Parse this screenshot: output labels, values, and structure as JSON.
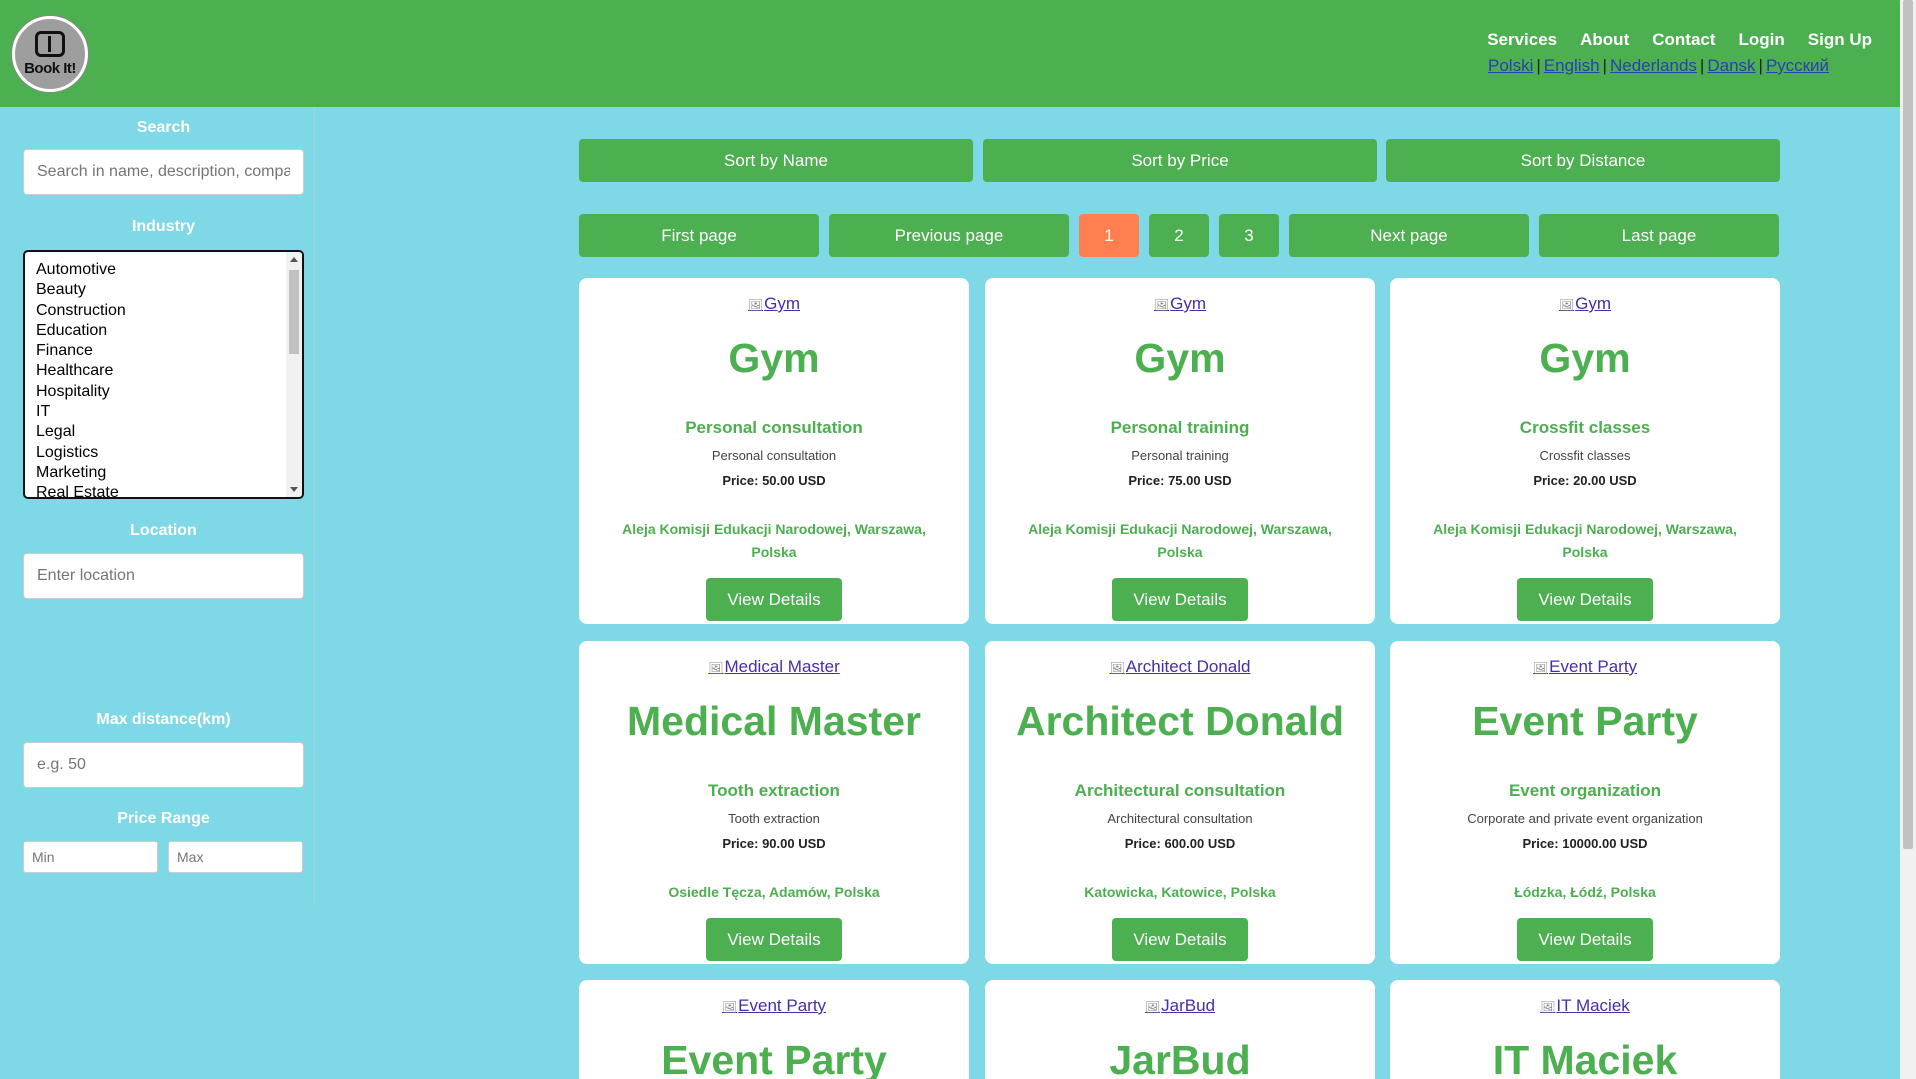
{
  "header": {
    "logo_text": "Book It!",
    "nav": [
      "Services",
      "About",
      "Contact",
      "Login",
      "Sign Up"
    ],
    "languages": [
      "Polski",
      "English",
      "Nederlands",
      "Dansk",
      "Русский"
    ]
  },
  "sidebar": {
    "search": {
      "label": "Search",
      "placeholder": "Search in name, description, company"
    },
    "industry": {
      "label": "Industry",
      "options": [
        "Automotive",
        "Beauty",
        "Construction",
        "Education",
        "Finance",
        "Healthcare",
        "Hospitality",
        "IT",
        "Legal",
        "Logistics",
        "Marketing",
        "Real Estate"
      ]
    },
    "location": {
      "label": "Location",
      "placeholder": "Enter location"
    },
    "max_distance": {
      "label": "Max distance(km)",
      "placeholder": "e.g. 50"
    },
    "price_range": {
      "label": "Price Range",
      "min_placeholder": "Min",
      "max_placeholder": "Max"
    }
  },
  "sort": [
    "Sort by Name",
    "Sort by Price",
    "Sort by Distance"
  ],
  "pagination": {
    "first": "First page",
    "previous": "Previous page",
    "pages": [
      "1",
      "2",
      "3"
    ],
    "current": "1",
    "next": "Next page",
    "last": "Last page"
  },
  "cards": [
    {
      "img_alt": "Gym",
      "title": "Gym",
      "service": "Personal consultation",
      "desc": "Personal consultation",
      "price": "Price: 50.00 USD",
      "address": "Aleja Komisji Edukacji Narodowej, Warszawa, Polska",
      "button": "View Details"
    },
    {
      "img_alt": "Gym",
      "title": "Gym",
      "service": "Personal training",
      "desc": "Personal training",
      "price": "Price: 75.00 USD",
      "address": "Aleja Komisji Edukacji Narodowej, Warszawa, Polska",
      "button": "View Details"
    },
    {
      "img_alt": "Gym",
      "title": "Gym",
      "service": "Crossfit classes",
      "desc": "Crossfit classes",
      "price": "Price: 20.00 USD",
      "address": "Aleja Komisji Edukacji Narodowej, Warszawa, Polska",
      "button": "View Details"
    },
    {
      "img_alt": "Medical Master",
      "title": "Medical Master",
      "service": "Tooth extraction",
      "desc": "Tooth extraction",
      "price": "Price: 90.00 USD",
      "address": "Osiedle Tęcza, Adamów, Polska",
      "button": "View Details"
    },
    {
      "img_alt": "Architect Donald",
      "title": "Architect Donald",
      "service": "Architectural consultation",
      "desc": "Architectural consultation",
      "price": "Price: 600.00 USD",
      "address": "Katowicka, Katowice, Polska",
      "button": "View Details"
    },
    {
      "img_alt": "Event Party",
      "title": "Event Party",
      "service": "Event organization",
      "desc": "Corporate and private event organization",
      "price": "Price: 10000.00 USD",
      "address": "Łódzka, Łódź, Polska",
      "button": "View Details"
    },
    {
      "img_alt": "Event Party",
      "title": "Event Party"
    },
    {
      "img_alt": "JarBud",
      "title": "JarBud"
    },
    {
      "img_alt": "IT Maciek",
      "title": "IT Maciek"
    }
  ]
}
